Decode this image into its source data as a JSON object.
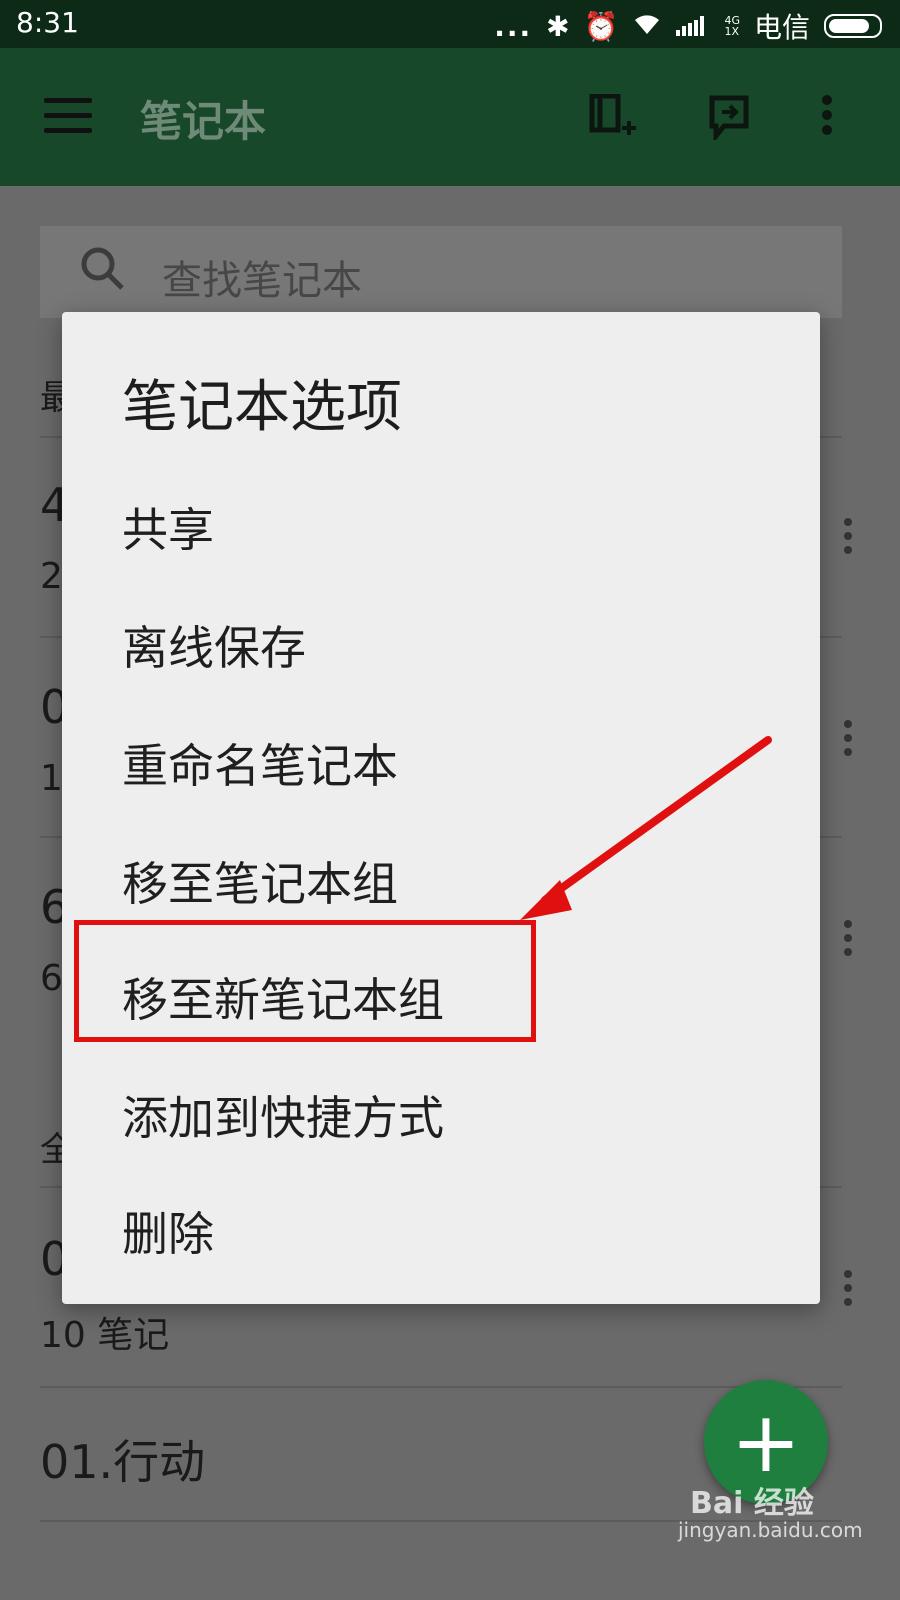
{
  "status": {
    "time": "8:31",
    "dots": "...",
    "network_top": "4G",
    "network_bottom": "1X",
    "carrier": "电信"
  },
  "appbar": {
    "title": "笔记本",
    "icons": [
      "menu-icon",
      "new-notebook-icon",
      "sync-icon",
      "more-icon"
    ]
  },
  "search": {
    "placeholder": "查找笔记本"
  },
  "background_list": {
    "section_recent_prefix": "最",
    "items": [
      {
        "name_prefix": "4",
        "sub_prefix": "2"
      },
      {
        "name_prefix": "0",
        "sub_prefix": "1"
      },
      {
        "name_prefix": "6",
        "sub_prefix": "6"
      }
    ],
    "section_all_prefix": "全",
    "item_partial_prefix": "0",
    "item_partial_sub": "10 笔记",
    "item_full": "01.行动"
  },
  "dialog": {
    "title": "笔记本选项",
    "options": [
      "共享",
      "离线保存",
      "重命名笔记本",
      "移至笔记本组",
      "移至新笔记本组",
      "添加到快捷方式",
      "删除"
    ],
    "highlighted_index": 4
  },
  "fab": {
    "label": "+"
  },
  "watermark": {
    "line1": "Bai 经验",
    "line2": "jingyan.baidu.com"
  },
  "colors": {
    "appbar": "#17482a",
    "highlight": "#e01010",
    "arrow": "#e01010",
    "fab": "#1f7f3e"
  }
}
